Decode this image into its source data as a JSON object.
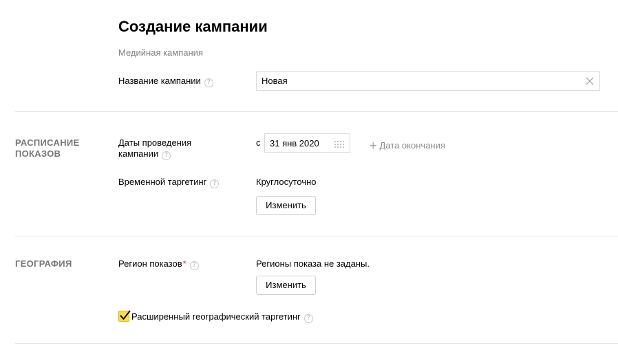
{
  "header": {
    "title": "Создание кампании",
    "subtitle": "Медийная кампания"
  },
  "campaign_name": {
    "label": "Название кампании",
    "value": "Новая"
  },
  "schedule": {
    "section_title": "РАСПИСАНИЕ ПОКАЗОВ",
    "dates_label_line1": "Даты проведения",
    "dates_label_line2": "кампании",
    "date_prefix": "с",
    "start_date": "31 янв 2020",
    "add_end_date": "Дата окончания",
    "time_targeting_label": "Временной таргетинг",
    "time_targeting_value": "Круглосуточно",
    "change_button": "Изменить"
  },
  "geography": {
    "section_title": "ГЕОГРАФИЯ",
    "region_label": "Регион показов",
    "required_mark": "*",
    "region_value": "Регионы показа не заданы.",
    "change_button": "Изменить",
    "extended_targeting_label": "Расширенный географический таргетинг",
    "extended_targeting_checked": true
  },
  "icons": {
    "help": "?",
    "help_icon_name": "question-circle-icon",
    "clear_icon_name": "close-icon",
    "calendar_icon_name": "calendar-icon",
    "plus_icon_name": "plus-icon",
    "checkmark_icon_name": "checkmark-icon"
  },
  "colors": {
    "checkbox_fill": "#ffdb4d",
    "required": "#e53935",
    "muted_text": "#808080",
    "divider": "#e3e3e3"
  }
}
